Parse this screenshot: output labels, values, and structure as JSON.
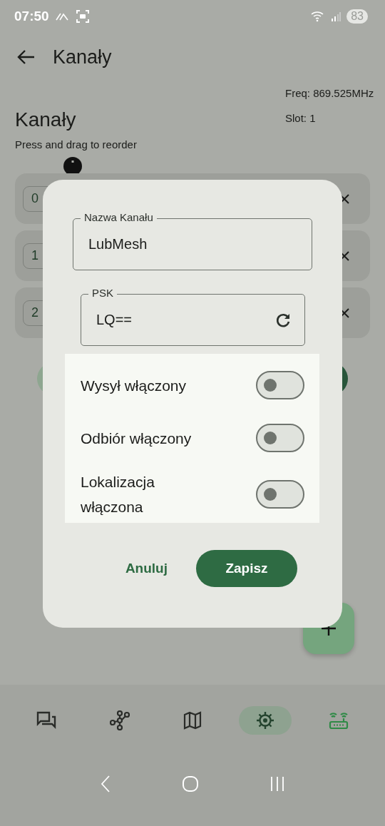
{
  "status_bar": {
    "time": "07:50",
    "battery": "83"
  },
  "top_bar": {
    "title": "Kanały"
  },
  "header": {
    "title": "Kanały",
    "freq": "Freq: 869.525MHz",
    "slot": "Slot: 1",
    "hint": "Press and drag to reorder"
  },
  "channels": [
    {
      "index": "0"
    },
    {
      "index": "1"
    },
    {
      "index": "2"
    }
  ],
  "dialog": {
    "name_field": {
      "label": "Nazwa Kanału",
      "value": "LubMesh"
    },
    "psk_field": {
      "label": "PSK",
      "value": "LQ=="
    },
    "toggles": [
      {
        "label": "Wysył włączony",
        "on": false
      },
      {
        "label": "Odbiór włączony",
        "on": false
      },
      {
        "label": "Lokalizacja włączona",
        "on": false
      }
    ],
    "buttons": [
      {
        "label": "Anuluj",
        "kind": "text"
      },
      {
        "label": "Zapisz",
        "kind": "filled"
      }
    ]
  },
  "nav": [
    {
      "kind": "chat",
      "selected": false
    },
    {
      "kind": "nodes",
      "selected": false
    },
    {
      "kind": "map",
      "selected": false
    },
    {
      "kind": "settings",
      "selected": true
    },
    {
      "kind": "router",
      "selected": false
    }
  ]
}
